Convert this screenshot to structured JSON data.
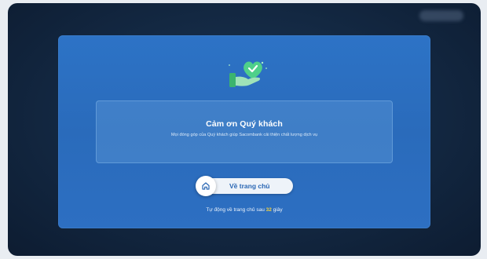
{
  "brand": {
    "logo_text": "Sacombank"
  },
  "thank_you": {
    "title": "Cảm ơn Quý khách",
    "subtitle": "Mọi đóng góp của Quý khách giúp Sacombank cải thiện chất lượng dịch vụ"
  },
  "home_button": {
    "label": "Về trang chủ",
    "icon": "home-icon"
  },
  "countdown": {
    "prefix": "Tự động về trang chủ sau",
    "seconds": "32",
    "suffix": "giây"
  },
  "colors": {
    "background": "#142a45",
    "card": "#2d6fc2",
    "accent_yellow": "#f6d23a",
    "heart_green": "#4fd08a"
  }
}
